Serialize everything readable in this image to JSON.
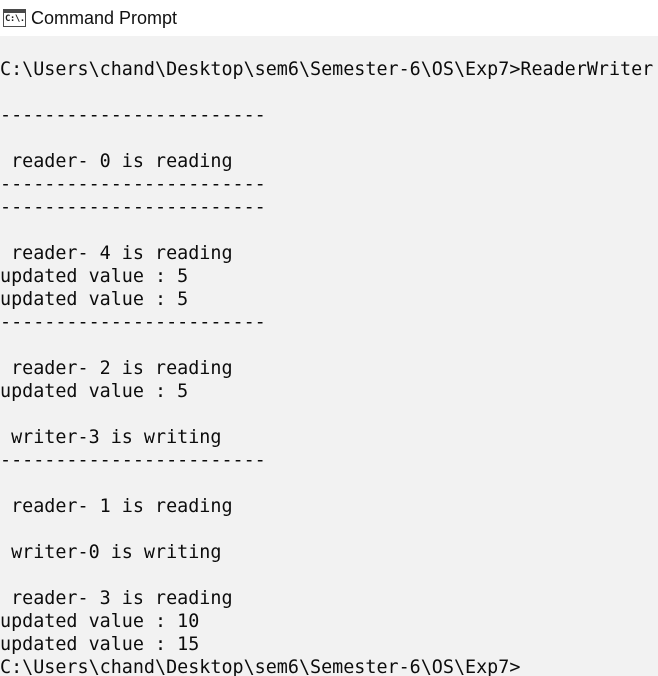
{
  "window": {
    "title": "Command Prompt",
    "icon": "cmd-icon",
    "icon_glyph": "C:\\."
  },
  "console": {
    "lines": [
      "C:\\Users\\chand\\Desktop\\sem6\\Semester-6\\OS\\Exp7>ReaderWriter",
      "",
      "------------------------",
      "",
      " reader- 0 is reading",
      "------------------------",
      "------------------------",
      "",
      " reader- 4 is reading",
      "updated value : 5",
      "updated value : 5",
      "------------------------",
      "",
      " reader- 2 is reading",
      "updated value : 5",
      "",
      " writer-3 is writing",
      "------------------------",
      "",
      " reader- 1 is reading",
      "",
      " writer-0 is writing",
      "",
      " reader- 3 is reading",
      "updated value : 10",
      "updated value : 15",
      "C:\\Users\\chand\\Desktop\\sem6\\Semester-6\\OS\\Exp7>"
    ]
  },
  "colors": {
    "console_bg": "#f2f2f2",
    "text": "#0c0c0c"
  }
}
